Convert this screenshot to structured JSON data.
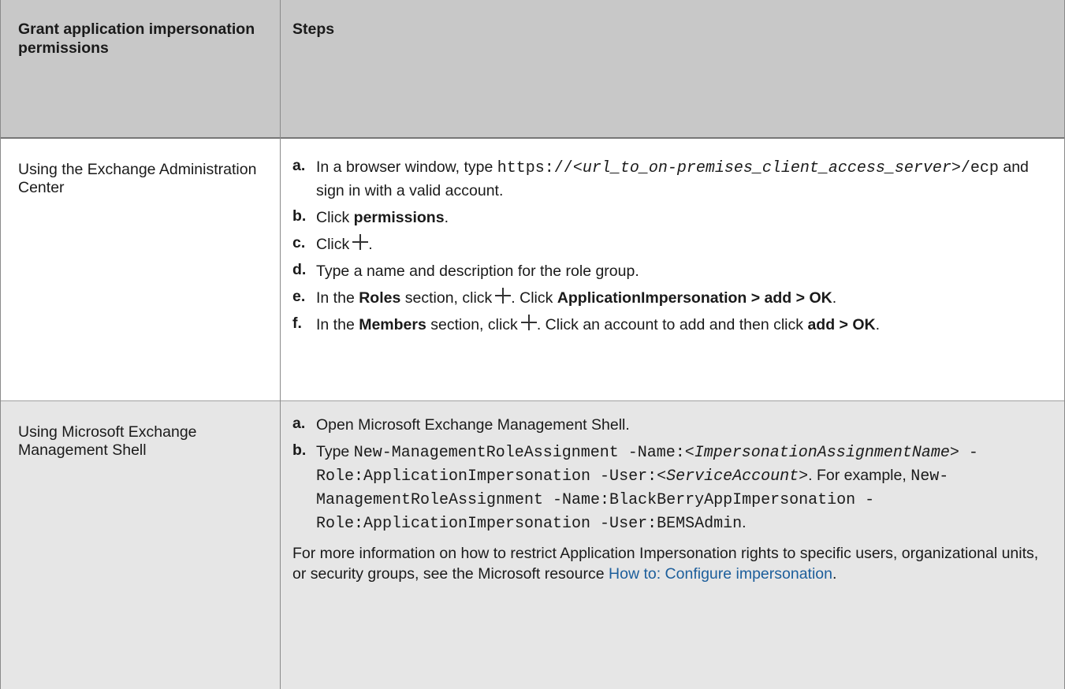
{
  "table": {
    "headers": [
      "Grant application impersonation permissions",
      "Steps"
    ],
    "rows": [
      {
        "method": "Using the Exchange Administration Center",
        "steps": {
          "a": {
            "label": "a.",
            "t1": "In a browser window, type",
            "code1": "https://",
            "code2": "<url_to_on-premises_client_access_server>",
            "code3": "/ecp",
            "t2": "and sign in with a valid account."
          },
          "b": {
            "label": "b.",
            "t1": "Click",
            "bold1": "permissions",
            "t2": "."
          },
          "c": {
            "label": "c.",
            "t1": "Click",
            "icon": "plus-icon",
            "t2": "."
          },
          "d": {
            "label": "d.",
            "t1": "Type a name and description for the role group."
          },
          "e": {
            "label": "e.",
            "t1": "In the",
            "bold1": "Roles",
            "t2": "section, click",
            "icon": "plus-icon",
            "t3": ". Click",
            "bold2": "ApplicationImpersonation > add > OK",
            "t4": "."
          },
          "f": {
            "label": "f.",
            "t1": "In the",
            "bold1": "Members",
            "t2": "section, click",
            "icon": "plus-icon",
            "t3": ". Click an account to add and then click",
            "bold2": "add > OK",
            "t4": "."
          }
        }
      },
      {
        "method": "Using Microsoft Exchange Management Shell",
        "steps": {
          "a": {
            "label": "a.",
            "t1": "Open Microsoft Exchange Management Shell."
          },
          "b": {
            "label": "b.",
            "t1": "Type",
            "code1": "New-ManagementRoleAssignment -Name:<",
            "code1i": "ImpersonationAssignmentName",
            "code2": "> -Role:ApplicationImpersonation -User:<",
            "code2i": "ServiceAccount",
            "code3": ">",
            "t2": ".",
            "t3": "For example,",
            "code4": "New-ManagementRoleAssignment -Name:BlackBerryAppImpersonation -Role:ApplicationImpersonation -User:BEMSAdmin",
            "t4": "."
          }
        },
        "note": {
          "text": "For more information on how to restrict Application Impersonation rights to specific users, organizational units, or security groups, see the Microsoft resource",
          "link": "How to: Configure impersonation",
          "end": "."
        }
      }
    ]
  },
  "colors": {
    "header_bg": "#c8c8c8",
    "alt_row_bg": "#e6e6e6",
    "link": "#1c5e9b"
  }
}
